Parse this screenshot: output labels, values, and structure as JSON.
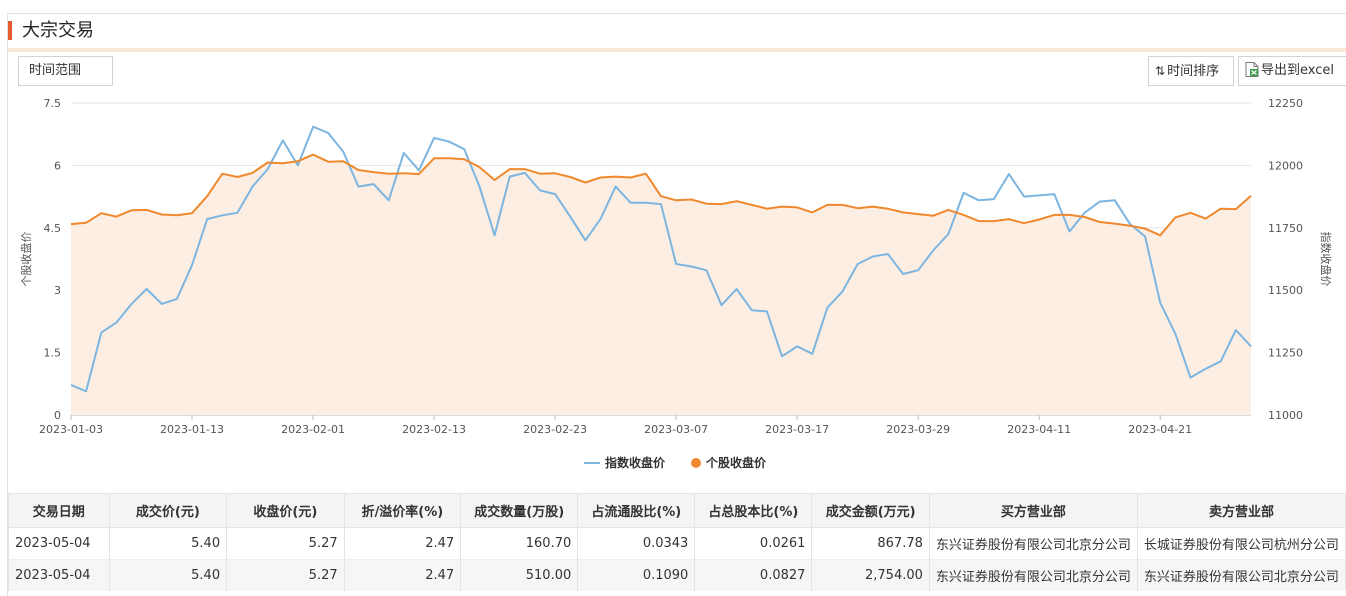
{
  "header": {
    "title": "大宗交易"
  },
  "toolbar": {
    "range_label": "时间范围",
    "sort_label": "时间排序",
    "sort_icon": "⇅",
    "export_label": "导出到excel"
  },
  "colors": {
    "index_line": "#7cb5e0",
    "stock_line": "#f0882e",
    "area_fill": "#fdeee3",
    "accent": "#e65a2e"
  },
  "chart_data": {
    "type": "line",
    "ylabel_left": "个股收盘价",
    "ylabel_right": "指数收盘价",
    "y_left_ticks": [
      "0",
      "1.5",
      "3",
      "4.5",
      "6",
      "7.5"
    ],
    "y_right_ticks": [
      "11000",
      "11250",
      "11500",
      "11750",
      "12000",
      "12250"
    ],
    "ylim_left": [
      0,
      7.5
    ],
    "ylim_right": [
      11000,
      12250
    ],
    "x_ticks": [
      "2023-01-03",
      "2023-01-13",
      "2023-02-01",
      "2023-02-13",
      "2023-02-23",
      "2023-03-07",
      "2023-03-17",
      "2023-03-29",
      "2023-04-11",
      "2023-04-21"
    ],
    "x_tick_index": [
      0,
      8,
      16,
      24,
      32,
      40,
      48,
      56,
      64,
      72
    ],
    "legend_placement": "bottom-center",
    "series": [
      {
        "name": "指数收盘价",
        "axis": "right",
        "values": [
          11120,
          11095,
          11330,
          11370,
          11445,
          11505,
          11445,
          11465,
          11600,
          11785,
          11800,
          11810,
          11915,
          11985,
          12100,
          12000,
          12155,
          12130,
          12055,
          11915,
          11925,
          11860,
          12050,
          11980,
          12110,
          12095,
          12065,
          11915,
          11720,
          11955,
          11970,
          11900,
          11885,
          11795,
          11700,
          11785,
          11915,
          11850,
          11850,
          11845,
          11605,
          11595,
          11580,
          11440,
          11505,
          11420,
          11415,
          11235,
          11275,
          11245,
          11430,
          11495,
          11605,
          11635,
          11645,
          11565,
          11580,
          11660,
          11725,
          11890,
          11860,
          11865,
          11965,
          11875,
          11880,
          11885,
          11735,
          11810,
          11855,
          11860,
          11765,
          11715,
          11450,
          11325,
          11150,
          11185,
          11215,
          11340,
          11275
        ]
      },
      {
        "name": "个股收盘价",
        "axis": "left",
        "values": [
          4.59,
          4.62,
          4.85,
          4.77,
          4.92,
          4.93,
          4.82,
          4.8,
          4.85,
          5.26,
          5.8,
          5.72,
          5.82,
          6.07,
          6.05,
          6.1,
          6.26,
          6.09,
          6.1,
          5.89,
          5.84,
          5.8,
          5.81,
          5.79,
          6.17,
          6.17,
          6.15,
          5.96,
          5.65,
          5.91,
          5.91,
          5.8,
          5.81,
          5.72,
          5.59,
          5.71,
          5.73,
          5.71,
          5.8,
          5.26,
          5.16,
          5.18,
          5.08,
          5.07,
          5.14,
          5.05,
          4.96,
          5.01,
          4.99,
          4.87,
          5.05,
          5.05,
          4.97,
          5.01,
          4.96,
          4.87,
          4.83,
          4.79,
          4.93,
          4.81,
          4.66,
          4.66,
          4.71,
          4.61,
          4.7,
          4.81,
          4.81,
          4.76,
          4.64,
          4.6,
          4.55,
          4.48,
          4.32,
          4.75,
          4.86,
          4.72,
          4.96,
          4.95,
          5.27
        ]
      }
    ]
  },
  "table": {
    "columns": [
      "交易日期",
      "成交价(元)",
      "收盘价(元)",
      "折/溢价率(%)",
      "成交数量(万股)",
      "占流通股比(%)",
      "占总股本比(%)",
      "成交金额(万元)",
      "买方营业部",
      "卖方营业部"
    ],
    "rows": [
      {
        "date": "2023-05-04",
        "price": "5.40",
        "close": "5.27",
        "premium": "2.47",
        "volume": "160.70",
        "float_ratio": "0.0343",
        "total_ratio": "0.0261",
        "amount": "867.78",
        "buyer": "东兴证券股份有限公司北京分公司",
        "seller": "长城证券股份有限公司杭州分公司"
      },
      {
        "date": "2023-05-04",
        "price": "5.40",
        "close": "5.27",
        "premium": "2.47",
        "volume": "510.00",
        "float_ratio": "0.1090",
        "total_ratio": "0.0827",
        "amount": "2,754.00",
        "buyer": "东兴证券股份有限公司北京分公司",
        "seller": "东兴证券股份有限公司北京分公司"
      }
    ]
  }
}
